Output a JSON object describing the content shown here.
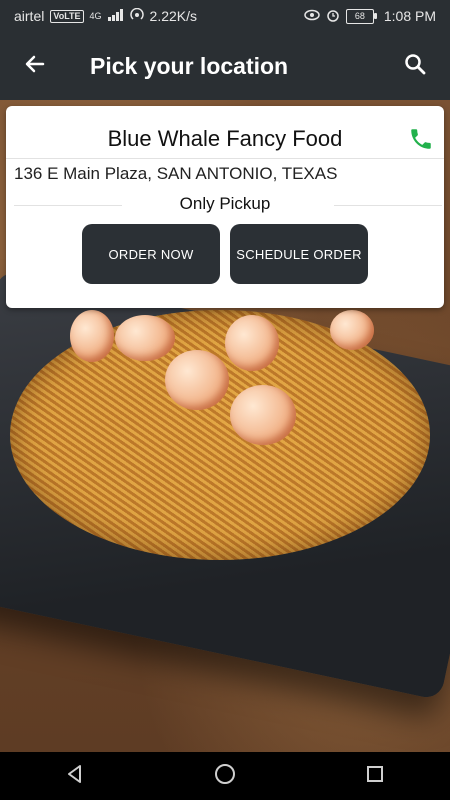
{
  "status_bar": {
    "carrier": "airtel",
    "volte": "VoLTE",
    "network": "4G",
    "speed": "2.22K/s",
    "battery": "68",
    "time": "1:08 PM"
  },
  "app_bar": {
    "title": "Pick your location",
    "icons": [
      "back-arrow-icon",
      "search-icon"
    ]
  },
  "card": {
    "restaurant_name": "Blue Whale Fancy Food",
    "address": "136 E Main Plaza, SAN ANTONIO, TEXAS",
    "service_mode": "Only Pickup",
    "order_now_label": "ORDER NOW",
    "schedule_order_label": "SCHEDULE ORDER",
    "phone_icon": "phone-icon"
  },
  "nav_bar": {
    "icons": [
      "back-triangle-icon",
      "home-circle-icon",
      "recents-square-icon"
    ]
  },
  "colors": {
    "app_bar": "#2a2f33",
    "button": "#2b3035",
    "phone_green": "#22b14c"
  }
}
